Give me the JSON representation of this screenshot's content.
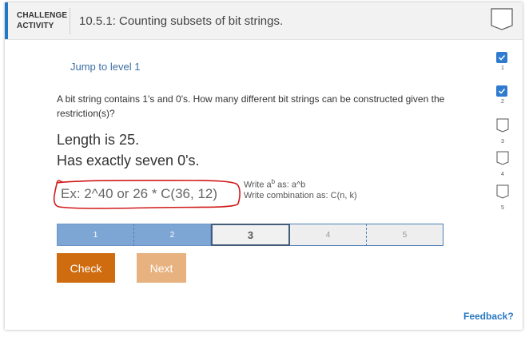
{
  "header": {
    "tag_line1": "CHALLENGE",
    "tag_line2": "ACTIVITY",
    "title": "10.5.1: Counting subsets of bit strings."
  },
  "jump_link": "Jump to level 1",
  "prompt": "A bit string contains 1's and 0's. How many different bit strings can be constructed given the restriction(s)?",
  "restrictions": [
    "Length is 25.",
    "Has exactly seven 0's."
  ],
  "answer_input": {
    "value": "",
    "placeholder": "Ex: 2^40 or 26 * C(36, 12)"
  },
  "hints": {
    "power_prefix": "Write a",
    "power_sup": "b",
    "power_suffix": " as: a^b",
    "combination": "Write combination as: C(n, k)"
  },
  "levels": [
    {
      "label": "1",
      "state": "completed"
    },
    {
      "label": "2",
      "state": "completed"
    },
    {
      "label": "3",
      "state": "current"
    },
    {
      "label": "4",
      "state": "locked"
    },
    {
      "label": "5",
      "state": "locked"
    }
  ],
  "buttons": {
    "check": "Check",
    "next": "Next"
  },
  "feedback_link": "Feedback?",
  "side_progress": [
    {
      "label": "1",
      "done": true
    },
    {
      "label": "2",
      "done": true
    },
    {
      "label": "3",
      "done": false
    },
    {
      "label": "4",
      "done": false
    },
    {
      "label": "5",
      "done": false
    }
  ],
  "colors": {
    "accent_blue": "#1f78c8",
    "check_button": "#cf6c0f",
    "next_button": "#e7b27f",
    "level_completed": "#7ea6d4",
    "annotation_red": "#d11a1a"
  }
}
